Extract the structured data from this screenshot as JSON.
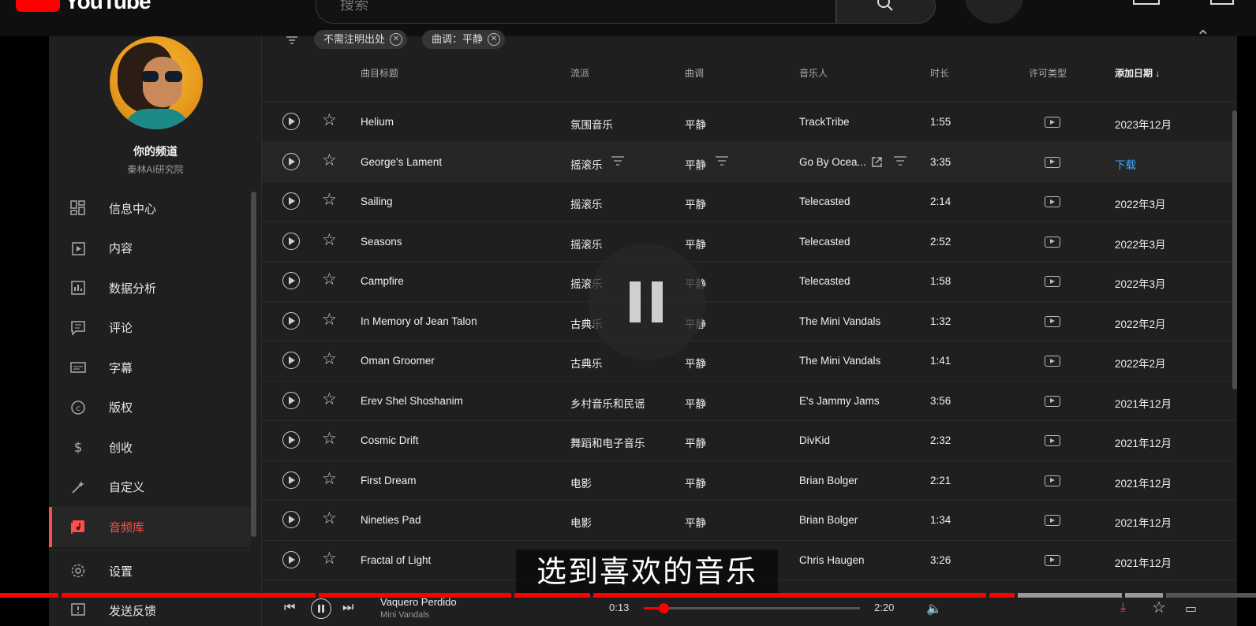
{
  "topbar": {
    "logo_text": "YouTube",
    "search_placeholder": "搜索"
  },
  "sidebar": {
    "channel_title": "你的频道",
    "channel_subtitle": "秦林AI研究院",
    "items": [
      {
        "label": "信息中心",
        "icon": "dashboard-icon"
      },
      {
        "label": "内容",
        "icon": "content-icon"
      },
      {
        "label": "数据分析",
        "icon": "analytics-icon"
      },
      {
        "label": "评论",
        "icon": "comments-icon"
      },
      {
        "label": "字幕",
        "icon": "subtitles-icon"
      },
      {
        "label": "版权",
        "icon": "copyright-icon"
      },
      {
        "label": "创收",
        "icon": "monetization-icon"
      },
      {
        "label": "自定义",
        "icon": "customization-icon"
      },
      {
        "label": "音频库",
        "icon": "audio-library-icon",
        "active": true
      }
    ],
    "bottom_items": [
      {
        "label": "设置",
        "icon": "settings-icon"
      },
      {
        "label": "发送反馈",
        "icon": "feedback-icon"
      }
    ]
  },
  "filters": {
    "chips": [
      {
        "label": "不需注明出处"
      },
      {
        "label": "曲调：平静"
      }
    ]
  },
  "table": {
    "headers": {
      "title": "曲目标题",
      "genre": "流派",
      "mood": "曲调",
      "artist": "音乐人",
      "duration": "时长",
      "license": "许可类型",
      "date_added": "添加日期"
    },
    "rows": [
      {
        "title": "Helium",
        "genre": "氛围音乐",
        "mood": "平静",
        "artist": "TrackTribe",
        "duration": "1:55",
        "date": "2023年12月"
      },
      {
        "title": "George's Lament",
        "genre": "摇滚乐",
        "mood": "平静",
        "artist": "Go By Ocea...",
        "duration": "3:35",
        "date": "下载",
        "hover": true
      },
      {
        "title": "Sailing",
        "genre": "摇滚乐",
        "mood": "平静",
        "artist": "Telecasted",
        "duration": "2:14",
        "date": "2022年3月"
      },
      {
        "title": "Seasons",
        "genre": "摇滚乐",
        "mood": "平静",
        "artist": "Telecasted",
        "duration": "2:52",
        "date": "2022年3月"
      },
      {
        "title": "Campfire",
        "genre": "摇滚乐",
        "mood": "平静",
        "artist": "Telecasted",
        "duration": "1:58",
        "date": "2022年3月"
      },
      {
        "title": "In Memory of Jean Talon",
        "genre": "古典乐",
        "mood": "平静",
        "artist": "The Mini Vandals",
        "duration": "1:32",
        "date": "2022年2月"
      },
      {
        "title": "Oman Groomer",
        "genre": "古典乐",
        "mood": "平静",
        "artist": "The Mini Vandals",
        "duration": "1:41",
        "date": "2022年2月"
      },
      {
        "title": "Erev Shel Shoshanim",
        "genre": "乡村音乐和民谣",
        "mood": "平静",
        "artist": "E's Jammy Jams",
        "duration": "3:56",
        "date": "2021年12月"
      },
      {
        "title": "Cosmic Drift",
        "genre": "舞蹈和电子音乐",
        "mood": "平静",
        "artist": "DivKid",
        "duration": "2:32",
        "date": "2021年12月"
      },
      {
        "title": "First Dream",
        "genre": "电影",
        "mood": "平静",
        "artist": "Brian Bolger",
        "duration": "2:21",
        "date": "2021年12月"
      },
      {
        "title": "Nineties Pad",
        "genre": "电影",
        "mood": "平静",
        "artist": "Brian Bolger",
        "duration": "1:34",
        "date": "2021年12月"
      },
      {
        "title": "Fractal of Light",
        "genre": "",
        "mood": "",
        "artist": "Chris Haugen",
        "duration": "3:26",
        "date": "2021年12月"
      }
    ]
  },
  "subtitle": "选到喜欢的音乐",
  "player": {
    "track_title": "Vaquero Perdido",
    "track_artist": "Mini Vandals",
    "current_time": "0:13",
    "total_time": "2:20",
    "progress": 0.09
  },
  "colors": {
    "accent": "#ff4e45",
    "link": "#3ea6ff",
    "progress": "#ff0000"
  }
}
